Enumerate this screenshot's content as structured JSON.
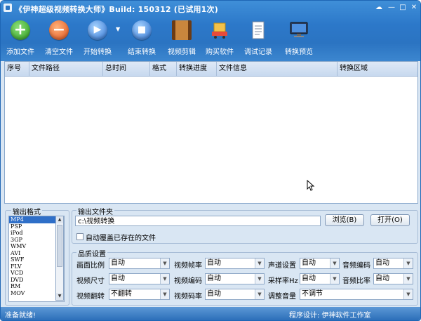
{
  "window": {
    "title": "《伊神超级视频转换大师》Build: 150312 (已试用1次)",
    "controls": [
      "☁",
      "—",
      "□",
      "✕"
    ]
  },
  "toolbar": {
    "add_label": "添加文件",
    "clear_label": "清空文件",
    "start_label": "开始转换",
    "stop_label": "结束转换",
    "edit_label": "视频剪辑",
    "buy_label": "购买软件",
    "log_label": "调试记录",
    "preview_label": "转换预览"
  },
  "grid": {
    "columns": [
      "序号",
      "文件路径",
      "总时间",
      "格式",
      "转换进度",
      "文件信息",
      "转换区域"
    ]
  },
  "output_format": {
    "label": "输出格式",
    "items": [
      "MP4",
      "PSP",
      "iPod",
      "3GP",
      "WMV",
      "AVI",
      "SWF",
      "FLV",
      "VCD",
      "DVD",
      "RM",
      "MOV"
    ],
    "selected": "MP4"
  },
  "output_folder": {
    "label": "输出文件夹",
    "path": "c:\\视频转换",
    "browse_label": "浏览(B)",
    "open_label": "打开(O)",
    "overwrite_label": "自动覆盖已存在的文件"
  },
  "quality": {
    "label": "品质设置",
    "aspect_label": "画面比例",
    "aspect_value": "自动",
    "size_label": "视频尺寸",
    "size_value": "自动",
    "flip_label": "视频翻转",
    "flip_value": "不翻转",
    "framerate_label": "视频帧率",
    "framerate_value": "自动",
    "vcodec_label": "视频编码",
    "vcodec_value": "自动",
    "bitrate_label": "视频码率",
    "bitrate_value": "自动",
    "channel_label": "声道设置",
    "channel_value": "自动",
    "samplerate_label": "采样率Hz",
    "samplerate_value": "自动",
    "volume_label": "调整音量",
    "volume_value": "不调节",
    "acodec_label": "音频编码",
    "acodec_value": "自动",
    "aratio_label": "音频比率",
    "aratio_value": "自动"
  },
  "status": {
    "left": "准备就绪!",
    "right": "程序设计: 伊神软件工作室"
  }
}
